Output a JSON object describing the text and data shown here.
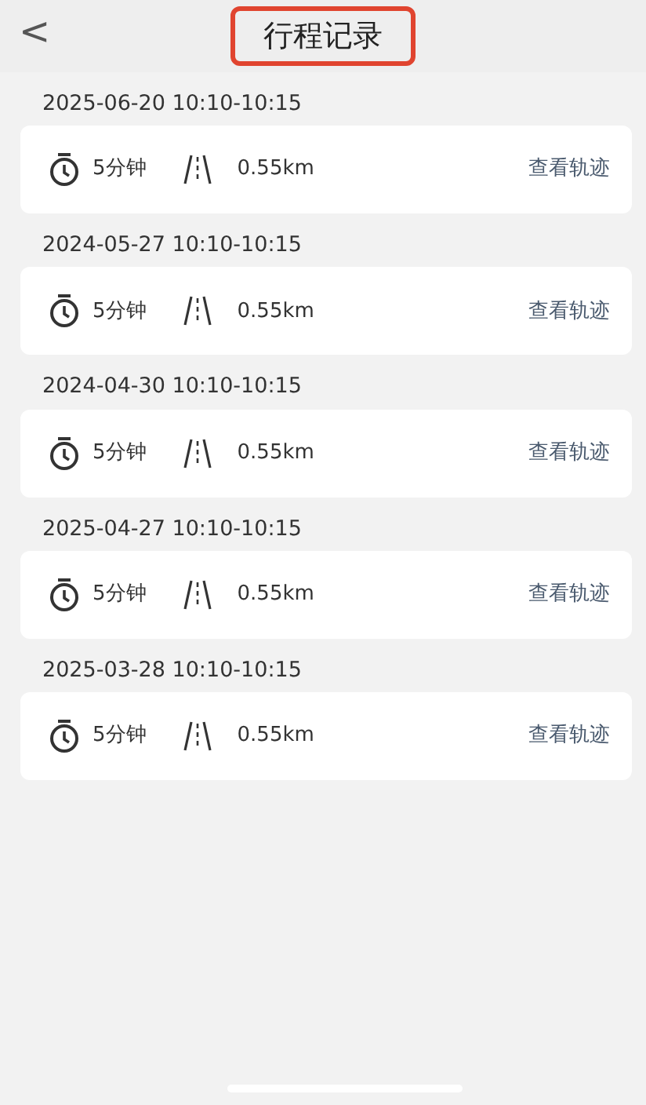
{
  "header": {
    "back": "<",
    "title": "行程记录",
    "highlighted": true
  },
  "trips": [
    {
      "date": "2025-06-20 10:10-10:15",
      "duration": "5分钟",
      "distance": "0.55km",
      "link": "查看轨迹"
    },
    {
      "date": "2024-05-27 10:10-10:15",
      "duration": "5分钟",
      "distance": "0.55km",
      "link": "查看轨迹"
    },
    {
      "date": "2024-04-30 10:10-10:15",
      "duration": "5分钟",
      "distance": "0.55km",
      "link": "查看轨迹"
    },
    {
      "date": "2025-04-27 10:10-10:15",
      "duration": "5分钟",
      "distance": "0.55km",
      "link": "查看轨迹"
    },
    {
      "date": "2025-03-28 10:10-10:15",
      "duration": "5分钟",
      "distance": "0.55km",
      "link": "查看轨迹"
    }
  ]
}
